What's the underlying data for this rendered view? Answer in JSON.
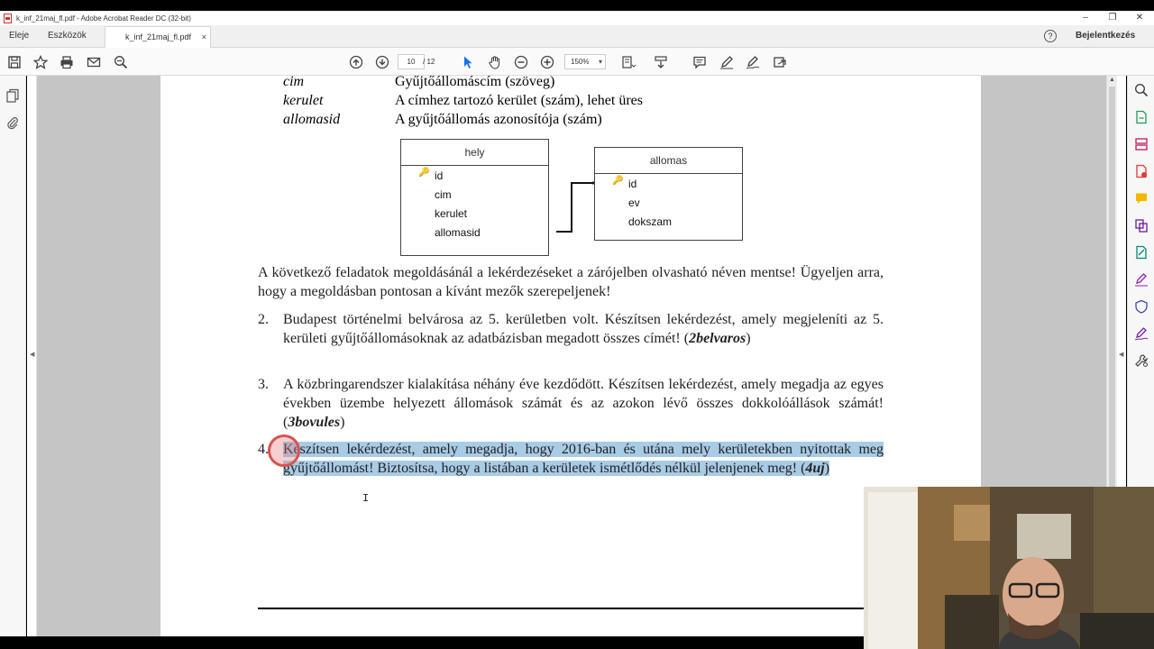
{
  "window": {
    "title": "k_inf_21maj_fl.pdf - Adobe Acrobat Reader DC (32-bit)",
    "minimize": "–",
    "maximize": "❐",
    "close": "✕"
  },
  "tabs": {
    "home": "Eleje",
    "tools": "Eszközök",
    "document": "k_inf_21maj_fl.pdf",
    "document_close": "×",
    "help": "?",
    "sign_in": "Bejelentkezés"
  },
  "toolbar": {
    "current_page": "10",
    "total_pages": "/ 12",
    "zoom": "150%"
  },
  "document": {
    "fields": [
      {
        "name": "cim",
        "desc": "Gyűjtőállomáscím (szöveg)"
      },
      {
        "name": "kerulet",
        "desc": "A címhez tartozó kerület (szám), lehet üres"
      },
      {
        "name": "allomasid",
        "desc": "A gyűjtőállomás azonosítója (szám)"
      }
    ],
    "diagram": {
      "table1": {
        "title": "hely",
        "rows": [
          "id",
          "cim",
          "kerulet",
          "allomasid"
        ]
      },
      "table2": {
        "title": "allomas",
        "rows": [
          "id",
          "ev",
          "dokszam"
        ]
      }
    },
    "intro": "A következő feladatok megoldásánál a lekérdezéseket a zárójelben olvasható néven mentse! Ügyeljen arra, hogy a megoldásban pontosan a kívánt mezők szerepeljenek!",
    "items": [
      {
        "num": "2.",
        "text": "Budapest történelmi belvárosa az 5. kerületben volt. Készítsen lekérdezést, amely megjeleníti az 5. kerületi gyűjtőállomásoknak az adatbázisban megadott összes címét! (",
        "name": "2belvaros",
        "close": ")"
      },
      {
        "num": "3.",
        "text": "A közbringarendszer kialakítása néhány éve kezdődött. Készítsen lekérdezést, amely megadja az egyes években üzembe helyezett állomások számát és az azokon lévő összes dokkolóállások számát! (",
        "name": "3bovules",
        "close": ")"
      },
      {
        "num": "4.",
        "text": "Készítsen lekérdezést, amely megadja, hogy 2016-ban és utána mely kerületekben nyitottak meg gyűjtőállomást! Biztosítsa, hogy a listában a kerületek ismétlődés nélkül jelenjenek meg! (",
        "name": "4uj",
        "close": ")"
      }
    ]
  },
  "colors": {
    "selection": "#a8cbe6",
    "accent_blue": "#1473e6",
    "cursor_ring": "#d9534f"
  },
  "icons": {
    "left": [
      "pages-icon",
      "attachment-icon"
    ],
    "toolbar": [
      "save-icon",
      "bookmark-star-icon",
      "print-icon",
      "email-icon",
      "search-zoom-icon",
      "page-up-icon",
      "page-down-icon",
      "select-arrow-icon",
      "hand-icon",
      "zoom-out-icon",
      "zoom-in-icon",
      "fit-page-icon",
      "scroll-mode-icon",
      "comment-icon",
      "highlight-pen-icon",
      "sign-icon",
      "share-icon"
    ],
    "right": [
      "search-icon",
      "export-pdf-icon",
      "organize-pages-icon",
      "create-pdf-icon",
      "comment-icon",
      "combine-files-icon",
      "edit-pdf-icon",
      "fill-sign-icon",
      "protect-icon",
      "sign-pen-icon",
      "more-tools-icon"
    ]
  }
}
